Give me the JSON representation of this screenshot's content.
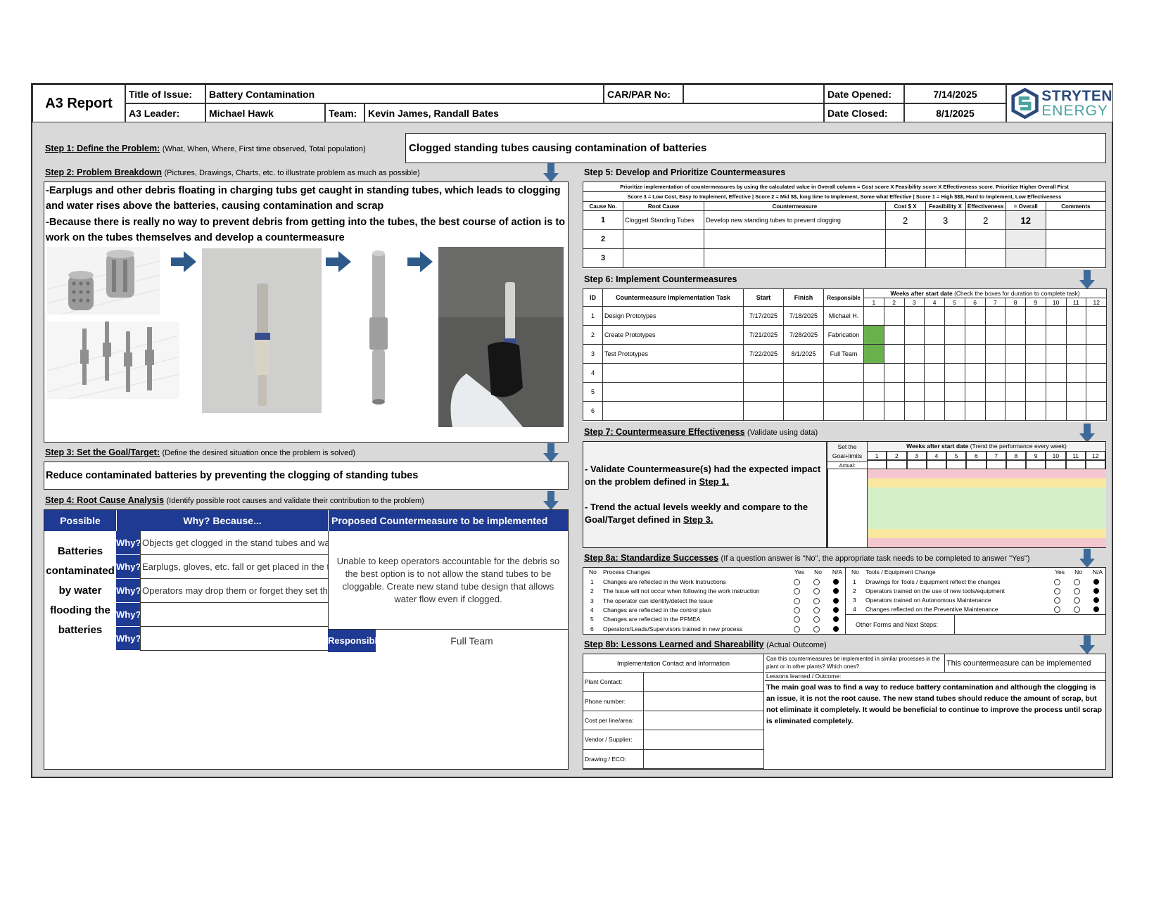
{
  "header": {
    "report_title": "A3 Report",
    "title_label": "Title of Issue:",
    "title_value": "Battery Contamination",
    "carpar_label": "CAR/PAR No:",
    "carpar_value": "",
    "date_opened_label": "Date Opened:",
    "date_opened_value": "7/14/2025",
    "leader_label": "A3 Leader:",
    "leader_value": "Michael Hawk",
    "team_label": "Team:",
    "team_value": "Kevin James, Randall Bates",
    "date_closed_label": "Date Closed:",
    "date_closed_value": "8/1/2025",
    "logo_line1": "STRYTEN",
    "logo_line2": "ENERGY"
  },
  "step1": {
    "title": "Step 1: Define the Problem:",
    "sub": "(What, When, Where, First time observed, Total population)",
    "text": "Clogged standing tubes causing contamination of batteries"
  },
  "step2": {
    "title": "Step 2: Problem Breakdown",
    "sub": "(Pictures, Drawings, Charts, etc. to illustrate problem as much as possible)",
    "line1": "-Earplugs and other debris floating in charging tubs get caught in standing tubes, which leads to clogging and water rises above the batteries, causing contamination and scrap",
    "line2": "-Because there is really no way to prevent debris from getting into the tubes, the best course of action is to work on the tubes themselves and develop a countermeasure"
  },
  "step3": {
    "title": "Step 3: Set the Goal/Target:",
    "sub": "(Define the desired situation once the problem is solved)",
    "text": "Reduce contaminated batteries by preventing the clogging of standing tubes"
  },
  "step4": {
    "title": "Step 4: Root Cause Analysis",
    "sub": "(Identify possible root causes and validate their contribution to the problem)",
    "col_cause": "Possible Cause",
    "col_why": "Why? Because...",
    "col_cm": "Proposed Countermeasure to be implemented",
    "cause": "Batteries contaminated by water flooding the batteries",
    "why_label": "Why?",
    "whys": [
      "Objects get clogged in the stand tubes and water can't flow",
      "Earplugs, gloves, etc. fall or get placed in the tubs",
      "Operators may drop them or forget they set them down",
      "",
      ""
    ],
    "countermeasure": "Unable to keep operators accountable for the debris so the best option is to not allow the stand tubes to be cloggable. Create new stand tube design that allows water flow even if clogged.",
    "responsible_label": "Responsible:",
    "responsible_value": "Full Team"
  },
  "step5": {
    "title": "Step 5: Develop and Prioritize Countermeasures",
    "note1": "Prioritize implementation of countermeasures by using the calculated value in Overall column = Cost score X Feasibility score X Effectiveness score. Prioritize Higher Overall First",
    "note2": "Score 3 = Low Cost, Easy to Implement, Effective  |  Score 2 = Mid $$, long time to Implement, Some what Effective  |  Score 1 = High $$$, Hard to Implement, Low Effectiveness",
    "headers": [
      "Cause No.",
      "Root Cause",
      "Countermeasure",
      "Cost $   X",
      "Feasibility X",
      "Effectiveness",
      "=   Overall",
      "Comments"
    ],
    "rows": [
      {
        "no": "1",
        "root": "Clogged Standing Tubes",
        "cm": "Develop new standing tubes to prevent clogging",
        "cost": "2",
        "feas": "3",
        "eff": "2",
        "overall": "12",
        "comments": ""
      },
      {
        "no": "2",
        "root": "",
        "cm": "",
        "cost": "",
        "feas": "",
        "eff": "",
        "overall": "",
        "comments": ""
      },
      {
        "no": "3",
        "root": "",
        "cm": "",
        "cost": "",
        "feas": "",
        "eff": "",
        "overall": "",
        "comments": ""
      }
    ]
  },
  "step6": {
    "title": "Step 6: Implement Countermeasures",
    "h_id": "ID",
    "h_task": "Countermeasure Implementation Task",
    "h_start": "Start",
    "h_finish": "Finish",
    "h_resp": "Responsible",
    "weeks_title": "Weeks after start date",
    "weeks_sub": "(Check the boxes for duration to complete task)",
    "weeks": [
      "1",
      "2",
      "3",
      "4",
      "5",
      "6",
      "7",
      "8",
      "9",
      "10",
      "11",
      "12"
    ],
    "rows": [
      {
        "id": "1",
        "task": "Design Prototypes",
        "start": "7/17/2025",
        "finish": "7/18/2025",
        "resp": "Michael H.",
        "filled": []
      },
      {
        "id": "2",
        "task": "Create Prototypes",
        "start": "7/21/2025",
        "finish": "7/28/2025",
        "resp": "Fabrication",
        "filled": [
          1
        ]
      },
      {
        "id": "3",
        "task": "Test Prototypes",
        "start": "7/22/2025",
        "finish": "8/1/2025",
        "resp": "Full Team",
        "filled": [
          1
        ]
      },
      {
        "id": "4",
        "task": "",
        "start": "",
        "finish": "",
        "resp": "",
        "filled": []
      },
      {
        "id": "5",
        "task": "",
        "start": "",
        "finish": "",
        "resp": "",
        "filled": []
      },
      {
        "id": "6",
        "task": "",
        "start": "",
        "finish": "",
        "resp": "",
        "filled": []
      }
    ],
    "fill_color": "#6ab04c"
  },
  "step7": {
    "title": "Step 7:  Countermeasure Effectiveness",
    "sub": "(Validate using data)",
    "text1a": "- Validate Countermeasure(s) had the expected impact on the problem defined in ",
    "text1b": "Step 1.",
    "text2a": "- Trend the actual levels weekly and compare to the Goal/Target defined in ",
    "text2b": "Step 3.",
    "set_goal": "Set the Goal+limits",
    "actual": "Actual:",
    "weeks_title": "Weeks after start date",
    "weeks_sub": "(Trend the performance every week)",
    "weeks": [
      "1",
      "2",
      "3",
      "4",
      "5",
      "6",
      "7",
      "8",
      "9",
      "10",
      "11",
      "12"
    ],
    "band_colors": [
      "#f4c7d0",
      "#f9e79f",
      "#d5efc9",
      "#f9e79f",
      "#f4c7d0"
    ]
  },
  "step8a": {
    "title": "Step 8a:  Standardize Successes",
    "sub": "(If a question answer is \"No\", the appropriate task needs to be completed to answer \"Yes\")",
    "left_h_no": "No",
    "left_h": "Process Changes",
    "h_yes": "Yes",
    "h_no": "No",
    "h_na": "N/A",
    "left": [
      {
        "n": "1",
        "t": "Changes are reflected in the Work Instructions"
      },
      {
        "n": "2",
        "t": "The Issue will not occur when following the work instruction"
      },
      {
        "n": "3",
        "t": "The operator can identify/detect the issue"
      },
      {
        "n": "4",
        "t": "Changes are reflected in the control plan"
      },
      {
        "n": "5",
        "t": "Changes are reflected in the PFMEA"
      },
      {
        "n": "6",
        "t": "Operators/Leads/Supervisors trained in new process"
      }
    ],
    "right_h_no": "No",
    "right_h": "Tools / Equipment Change",
    "right": [
      {
        "n": "1",
        "t": "Drawings for Tools / Equipment reflect the changes"
      },
      {
        "n": "2",
        "t": "Operators trained on the use of new tools/equipment"
      },
      {
        "n": "3",
        "t": "Operators trained on Autonomous Maintenance"
      },
      {
        "n": "4",
        "t": "Changes reflected on the Preventive Maintenance"
      }
    ],
    "other_forms": "Other Forms and Next Steps:"
  },
  "step8b": {
    "title": "Step 8b: Lessons Learned and Shareability",
    "sub": "(Actual Outcome)",
    "impl_contact": "Implementation Contact and Information",
    "question": "Can this countermeasures be implemented in similar processes in the plant or in other plants? Which ones?",
    "answer": "This countermeasure can be implemented",
    "lessons_label": "Lessons learned / Outcome:",
    "lessons": "The main goal was to find a way to reduce battery contamination and although the clogging is an issue, it is not the root cause. The new stand tubes should reduce the amount of scrap, but not eliminate it completely. It would be beneficial to continue to improve the process until scrap is eliminated completely.",
    "contacts": [
      "Plant Contact:",
      "Phone number:",
      "Cost per line/area:",
      "Vendor / Supplier:",
      "Drawing / ECO:"
    ]
  },
  "colors": {
    "blue": "#1f3a93",
    "arrow": "#3d6a99",
    "logo": "#2c4a7a",
    "logo_green": "#4aa3a3"
  }
}
